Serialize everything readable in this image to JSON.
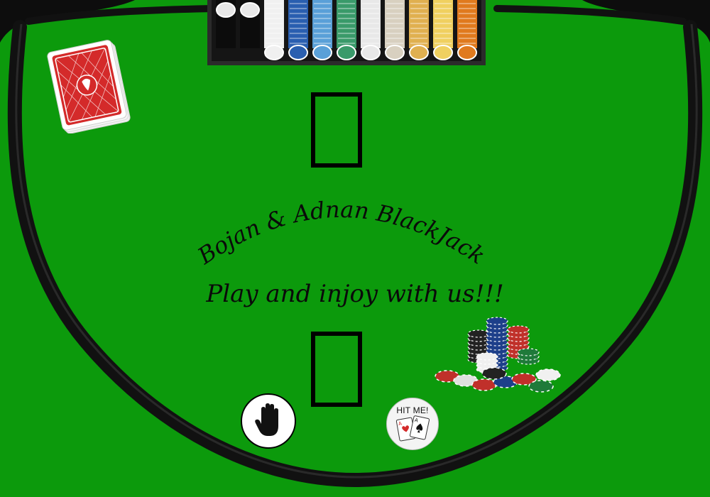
{
  "table": {
    "felt_color": "#0c9a0c",
    "rail_color": "#111111",
    "title": "Bojan & Adnan BlackJack",
    "tagline": "Play and injoy with us!!!"
  },
  "controls": {
    "hit_label": "HIT ME!",
    "stand_icon": "hand-stop-icon"
  },
  "slots": {
    "dealer": "dealer-card-slot",
    "player": "player-card-slot"
  },
  "decor": {
    "deck_color": "#d42a2a",
    "chip_colors": [
      "#1d3f8a",
      "#c0302a",
      "#1f7a3a",
      "#f0f0f0",
      "#222222",
      "#e08a1e",
      "#6a8fd0",
      "#2c7d7d"
    ]
  }
}
